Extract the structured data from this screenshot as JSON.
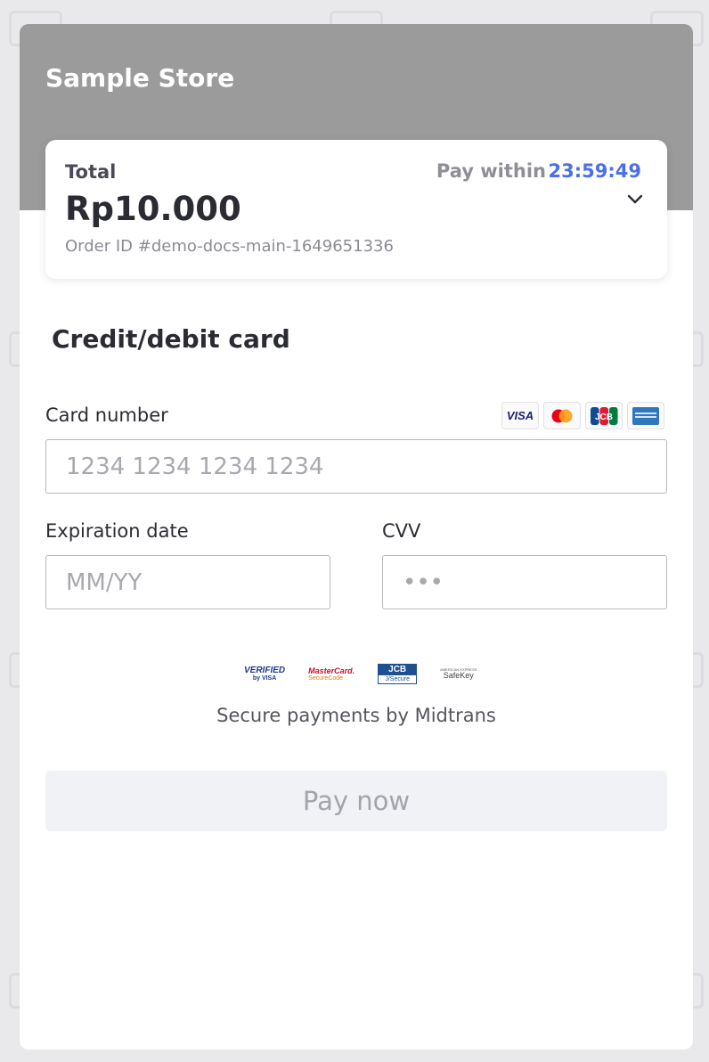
{
  "store": {
    "name": "Sample Store"
  },
  "summary": {
    "total_label": "Total",
    "amount": "Rp10.000",
    "order_id": "Order ID #demo-docs-main-1649651336",
    "pay_within_label": "Pay within",
    "timer": "23:59:49",
    "expand_icon": "chevron-down-icon"
  },
  "payment": {
    "section_title": "Credit/debit card",
    "card_number_label": "Card number",
    "card_number_placeholder": "1234 1234 1234 1234",
    "card_brands": [
      "VISA",
      "MasterCard",
      "JCB",
      "American Express"
    ],
    "expiry_label": "Expiration date",
    "expiry_placeholder": "MM/YY",
    "cvv_label": "CVV",
    "cvv_placeholder": "•••"
  },
  "security": {
    "badges": {
      "visa_line1": "VERIFIED",
      "visa_line2": "by VISA",
      "mc_line1": "MasterCard.",
      "mc_line2": "SecureCode",
      "jcb_line1": "JCB",
      "jcb_line2": "J/Secure",
      "amex_line1": "AMERICAN EXPRESS",
      "amex_line2": "SafeKey"
    },
    "text": "Secure payments by Midtrans"
  },
  "actions": {
    "pay_now": "Pay now"
  },
  "colors": {
    "header": "#9b9b9b",
    "timer": "#4c6fe8",
    "button_bg": "#f1f2f5",
    "button_text": "#a3a3ab"
  }
}
